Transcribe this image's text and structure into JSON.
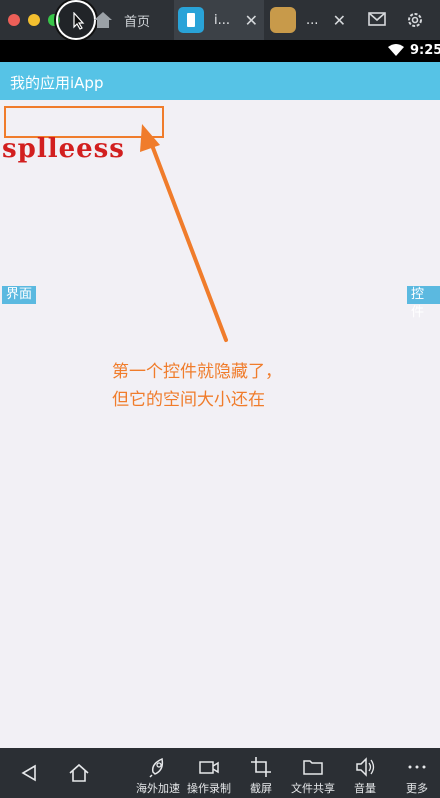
{
  "tabs": {
    "home_label": "首页",
    "active_label": "i...",
    "second_label": "...",
    "close_glyph": "✕"
  },
  "status": {
    "time": "9:25"
  },
  "app": {
    "title": "我的应用iApp",
    "text_value": "splleess",
    "left_tag": "界面",
    "right_tag": "控件"
  },
  "annotation": {
    "line1": "第一个控件就隐藏了，",
    "line2": "但它的空间大小还在"
  },
  "toolbar": {
    "back_icon": "back-triangle-icon",
    "home_icon": "home-icon",
    "items": [
      {
        "label": "海外加速",
        "icon": "rocket-icon"
      },
      {
        "label": "操作录制",
        "icon": "video-icon"
      },
      {
        "label": "截屏",
        "icon": "crop-icon"
      },
      {
        "label": "文件共享",
        "icon": "folder-icon"
      },
      {
        "label": "音量",
        "icon": "speaker-icon"
      },
      {
        "label": "更多",
        "icon": "more-icon"
      }
    ]
  },
  "colors": {
    "accent": "#56c3e6",
    "annotation": "#f07c2b",
    "text_red": "#d21f1f"
  }
}
